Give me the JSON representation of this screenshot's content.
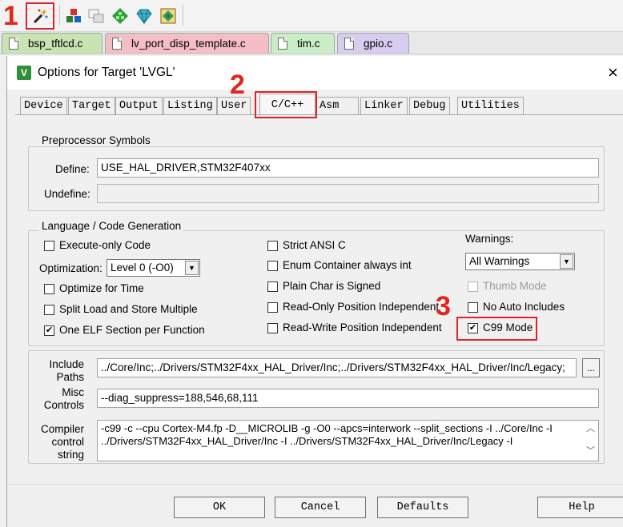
{
  "callouts": {
    "one": "1",
    "two": "2",
    "three": "3"
  },
  "toolbar": {
    "icons": [
      "options-for-target-icon",
      "manage-components-icon",
      "file-extensions-icon",
      "select-packs-icon",
      "pack-installer-icon",
      "run-time-env-icon"
    ]
  },
  "file_tabs": [
    {
      "label": "bsp_tftlcd.c",
      "color": "#c9e3b3"
    },
    {
      "label": "lv_port_disp_template.c",
      "color": "#f4bfc4"
    },
    {
      "label": "tim.c",
      "color": "#c9eec5"
    },
    {
      "label": "gpio.c",
      "color": "#d8ccef"
    }
  ],
  "dialog": {
    "title": "Options for Target 'LVGL'",
    "app_icon_glyph": "V",
    "close_glyph": "×",
    "tabs": [
      "Device",
      "Target",
      "Output",
      "Listing",
      "User",
      "C/C++",
      "Asm",
      "Linker",
      "Debug",
      "Utilities"
    ],
    "active_tab": "C/C++"
  },
  "preprocessor": {
    "title": "Preprocessor Symbols",
    "define_label": "Define:",
    "define_value": "USE_HAL_DRIVER,STM32F407xx",
    "undefine_label": "Undefine:",
    "undefine_value": ""
  },
  "language": {
    "title": "Language / Code Generation",
    "execute_only": {
      "label": "Execute-only Code",
      "checked": false
    },
    "optimization_label": "Optimization:",
    "optimization_value": "Level 0 (-O0)",
    "optimize_time": {
      "label": "Optimize for Time",
      "checked": false
    },
    "split_load": {
      "label": "Split Load and Store Multiple",
      "checked": false
    },
    "one_elf": {
      "label": "One ELF Section per Function",
      "checked": true
    },
    "strict_ansi": {
      "label": "Strict ANSI C",
      "checked": false
    },
    "enum_container": {
      "label": "Enum Container always int",
      "checked": false
    },
    "plain_char": {
      "label": "Plain Char is Signed",
      "checked": false
    },
    "ro_pos": {
      "label": "Read-Only Position Independent",
      "checked": false
    },
    "rw_pos": {
      "label": "Read-Write Position Independent",
      "checked": false
    },
    "warnings_label": "Warnings:",
    "warnings_value": "All Warnings",
    "thumb_mode": {
      "label": "Thumb Mode",
      "checked": false,
      "disabled": true
    },
    "no_auto_includes": {
      "label": "No Auto Includes",
      "checked": false
    },
    "c99_mode": {
      "label": "C99 Mode",
      "checked": true
    }
  },
  "include_paths": {
    "label_line1": "Include",
    "label_line2": "Paths",
    "value": "../Core/Inc;../Drivers/STM32F4xx_HAL_Driver/Inc;../Drivers/STM32F4xx_HAL_Driver/Inc/Legacy;",
    "browse_label": "..."
  },
  "misc_controls": {
    "label_line1": "Misc",
    "label_line2": "Controls",
    "value": "--diag_suppress=188,546,68,111"
  },
  "compiler_control": {
    "label_line1": "Compiler",
    "label_line2": "control",
    "label_line3": "string",
    "line1": "-c99 -c --cpu Cortex-M4.fp -D__MICROLIB -g -O0 --apcs=interwork --split_sections -I ../Core/Inc -I",
    "line2": "../Drivers/STM32F4xx_HAL_Driver/Inc -I ../Drivers/STM32F4xx_HAL_Driver/Inc/Legacy -I",
    "scroll_up": "︿",
    "scroll_down": "﹀"
  },
  "buttons": {
    "ok": "OK",
    "cancel": "Cancel",
    "defaults": "Defaults",
    "help": "Help"
  },
  "colors": {
    "accent_red": "#d9262c",
    "active_tab": "#f7f7f7"
  }
}
